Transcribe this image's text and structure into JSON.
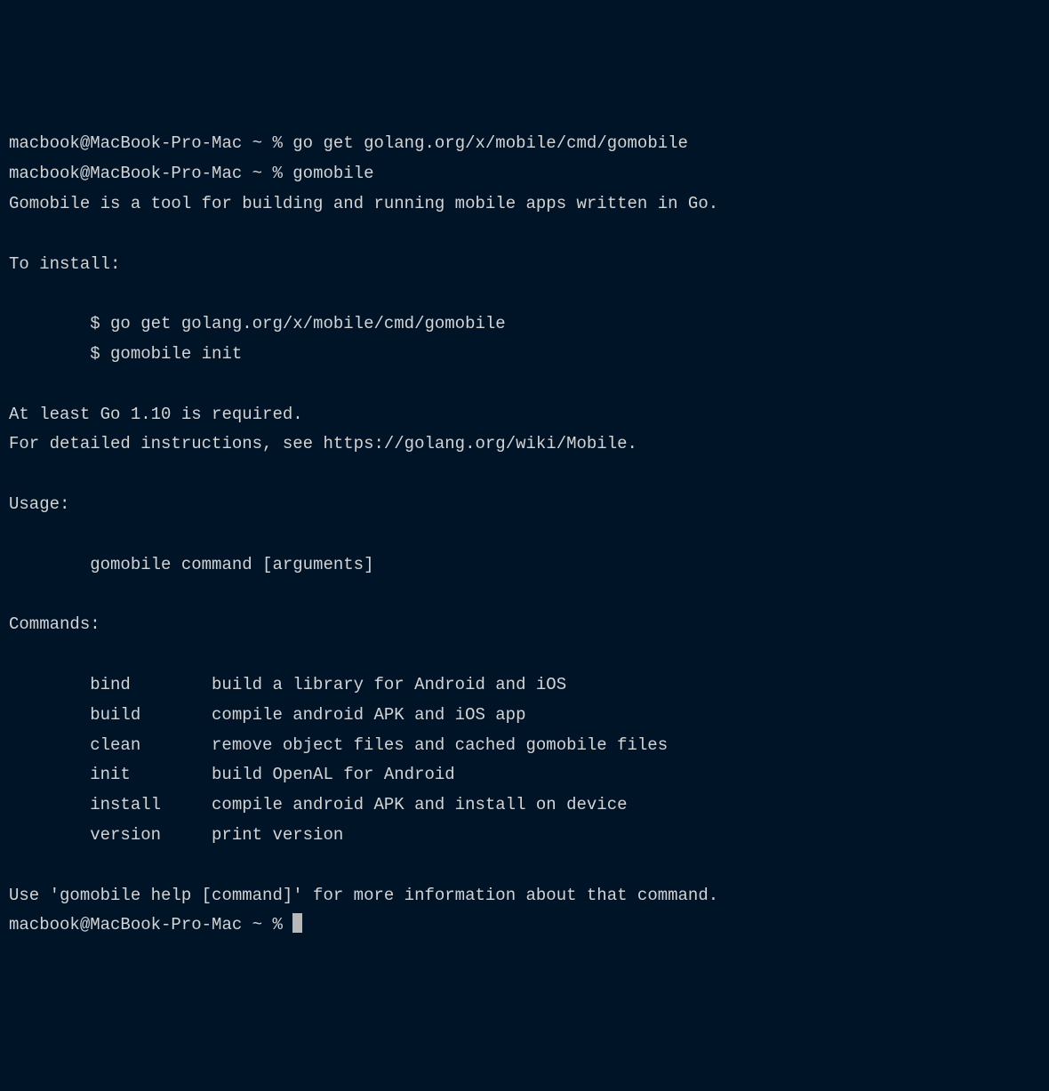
{
  "terminal": {
    "prompt": "macbook@MacBook-Pro-Mac ~ % ",
    "commands": [
      "go get golang.org/x/mobile/cmd/gomobile",
      "gomobile"
    ],
    "output": {
      "intro": "Gomobile is a tool for building and running mobile apps written in Go.",
      "install_header": "To install:",
      "install_cmd1": "$ go get golang.org/x/mobile/cmd/gomobile",
      "install_cmd2": "$ gomobile init",
      "req_line": "At least Go 1.10 is required.",
      "see_line": "For detailed instructions, see https://golang.org/wiki/Mobile.",
      "usage_header": "Usage:",
      "usage_line": "gomobile command [arguments]",
      "commands_header": "Commands:",
      "commands_table": [
        {
          "name": "bind",
          "desc": "build a library for Android and iOS"
        },
        {
          "name": "build",
          "desc": "compile android APK and iOS app"
        },
        {
          "name": "clean",
          "desc": "remove object files and cached gomobile files"
        },
        {
          "name": "init",
          "desc": "build OpenAL for Android"
        },
        {
          "name": "install",
          "desc": "compile android APK and install on device"
        },
        {
          "name": "version",
          "desc": "print version"
        }
      ],
      "footer": "Use 'gomobile help [command]' for more information about that command."
    }
  }
}
